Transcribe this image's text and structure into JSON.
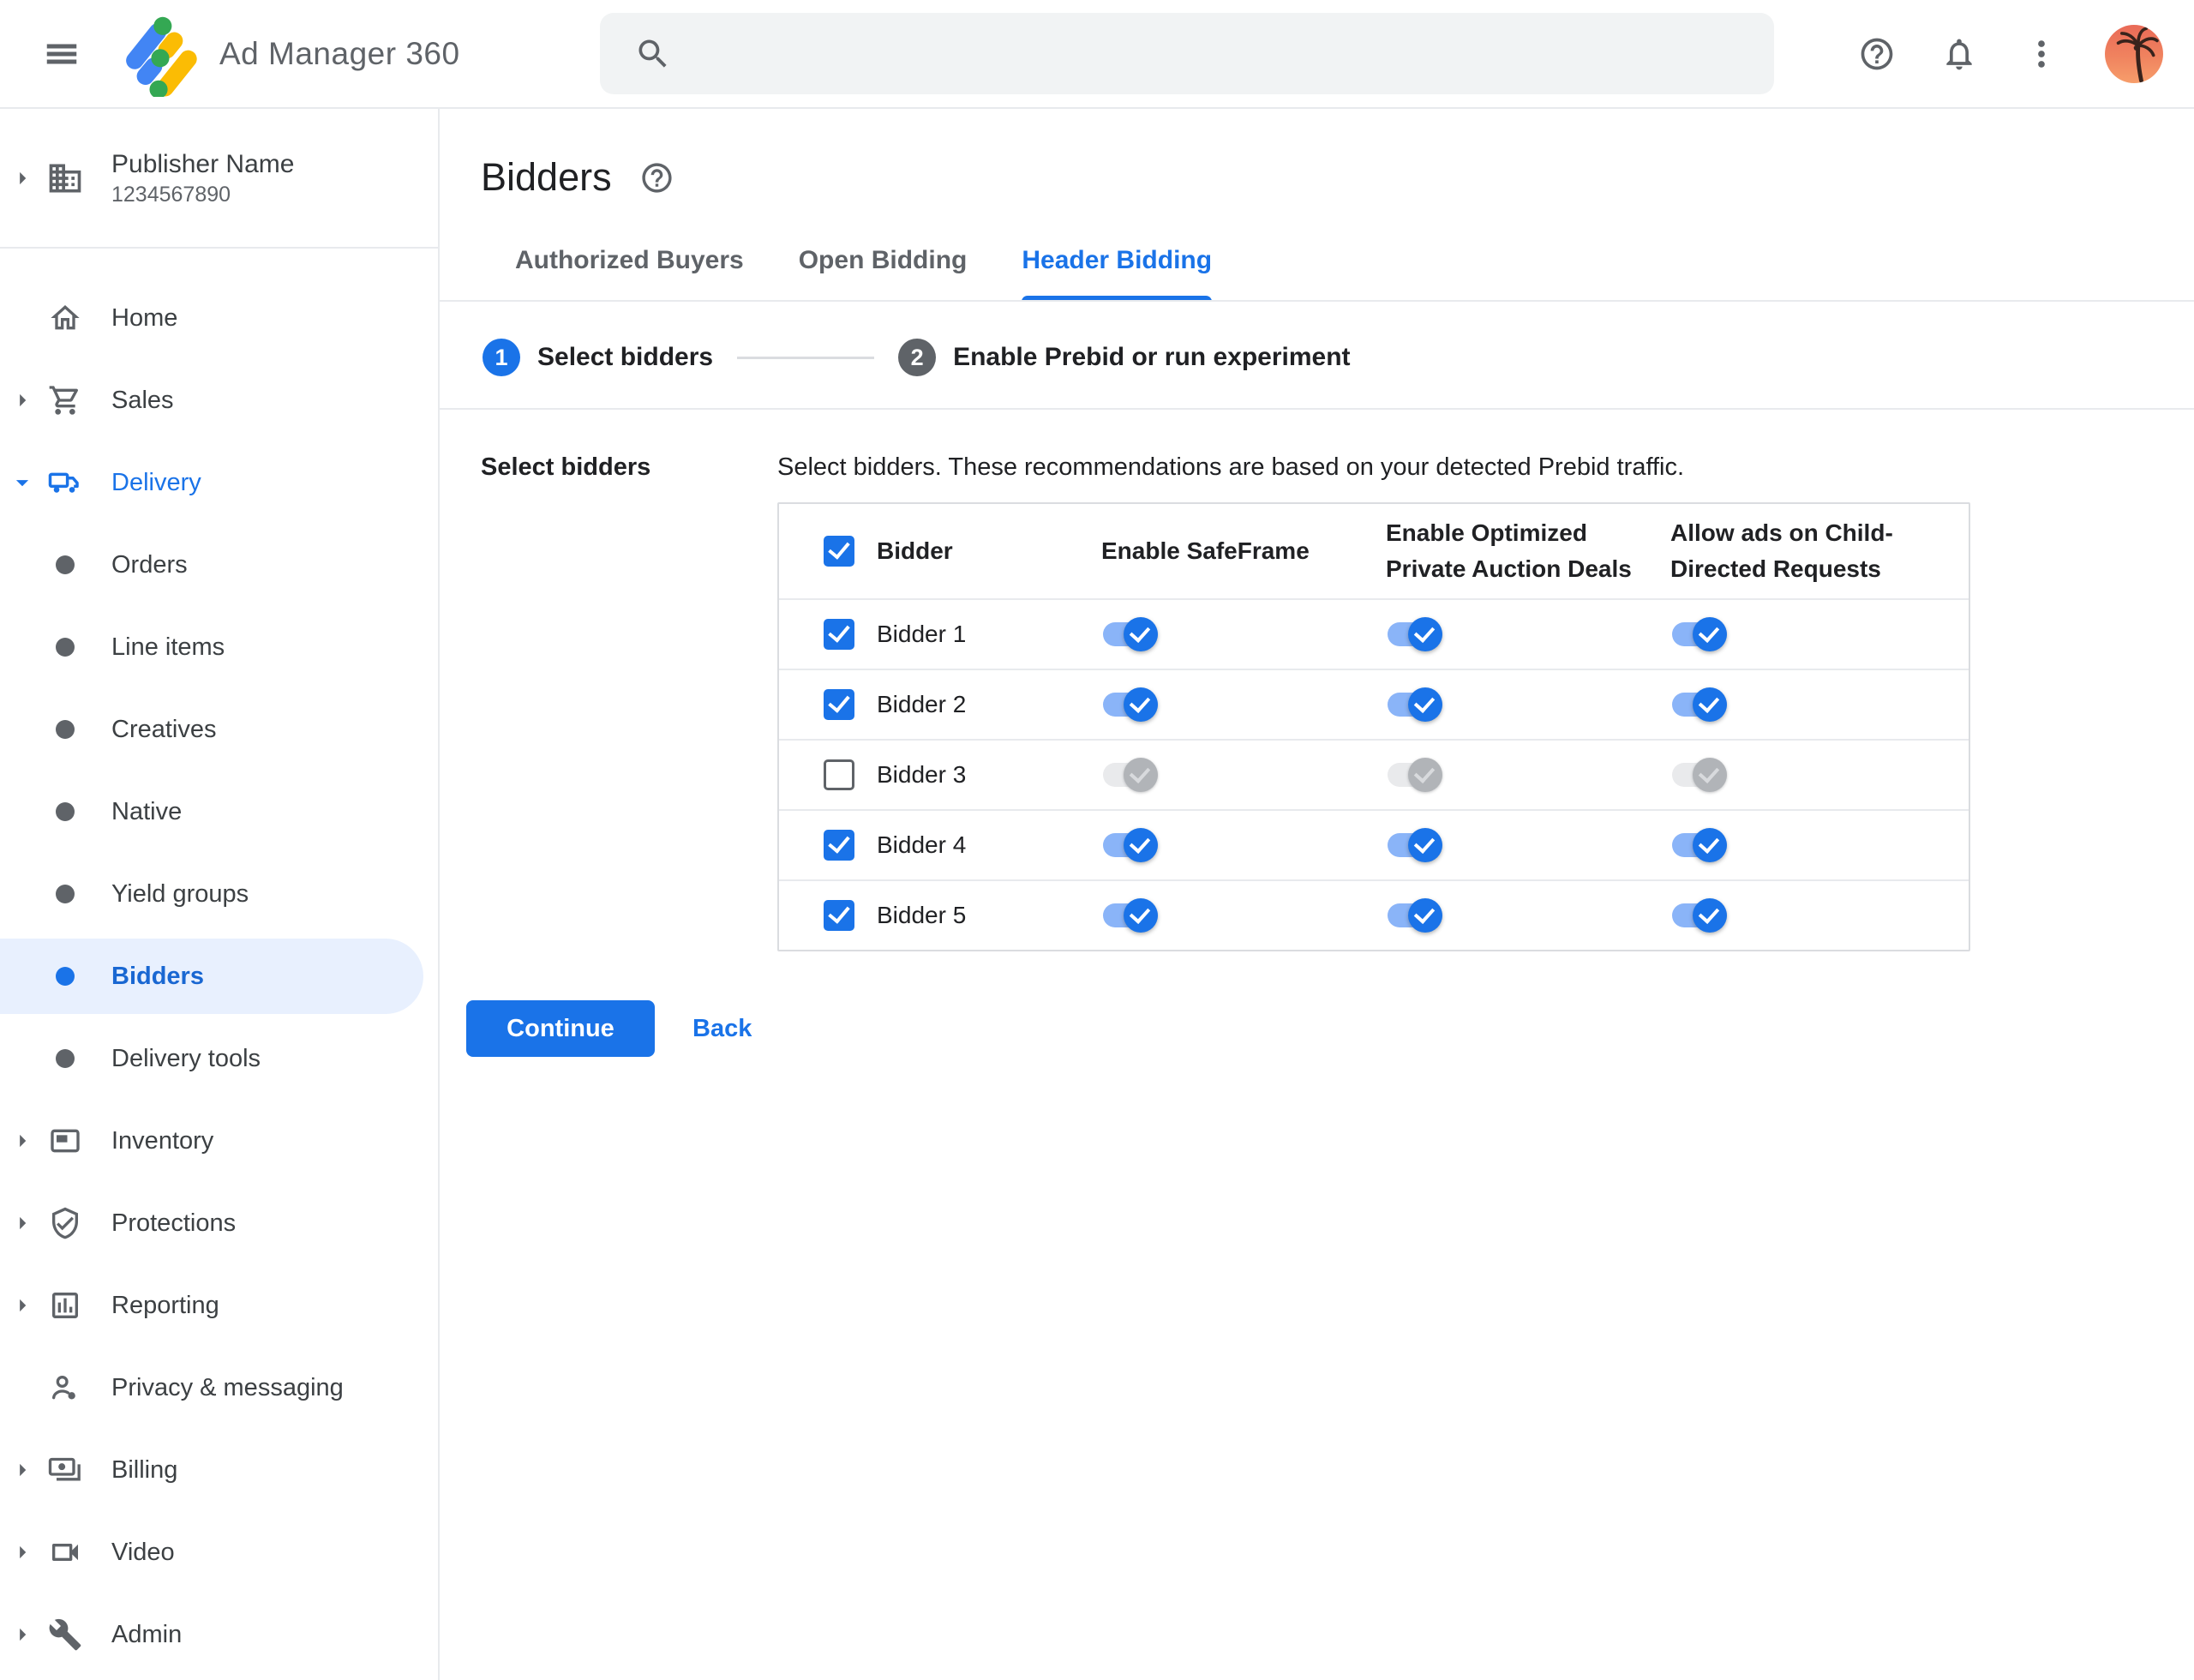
{
  "topbar": {
    "app_title": "Ad Manager 360",
    "search": {
      "value": "",
      "placeholder": ""
    }
  },
  "sidebar": {
    "publisher": {
      "name": "Publisher Name",
      "id": "1234567890"
    },
    "items": [
      {
        "label": "Home"
      },
      {
        "label": "Sales"
      },
      {
        "label": "Delivery"
      },
      {
        "label": "Orders"
      },
      {
        "label": "Line items"
      },
      {
        "label": "Creatives"
      },
      {
        "label": "Native"
      },
      {
        "label": "Yield groups"
      },
      {
        "label": "Bidders"
      },
      {
        "label": "Delivery tools"
      },
      {
        "label": "Inventory"
      },
      {
        "label": "Protections"
      },
      {
        "label": "Reporting"
      },
      {
        "label": "Privacy & messaging"
      },
      {
        "label": "Billing"
      },
      {
        "label": "Video"
      },
      {
        "label": "Admin"
      }
    ],
    "selected_item": "Bidders"
  },
  "main": {
    "page_title": "Bidders",
    "tabs": [
      {
        "label": "Authorized Buyers"
      },
      {
        "label": "Open Bidding"
      },
      {
        "label": "Header Bidding"
      }
    ],
    "active_tab": "Header Bidding",
    "stepper": [
      {
        "number": "1",
        "label": "Select bidders"
      },
      {
        "number": "2",
        "label": "Enable Prebid or run experiment"
      }
    ],
    "section_label": "Select bidders",
    "description": "Select bidders. These recommendations are based on your detected Prebid traffic.",
    "table": {
      "columns": [
        "Bidder",
        "Enable SafeFrame",
        "Enable Optimized Private Auction Deals",
        "Allow ads on Child-Directed Requests"
      ],
      "select_all_checked": true,
      "rows": [
        {
          "label": "Bidder 1",
          "selected": true,
          "enable_safeframe": true,
          "enable_optimized_private_auction_deals": true,
          "allow_ads_on_child_directed_requests": true
        },
        {
          "label": "Bidder 2",
          "selected": true,
          "enable_safeframe": true,
          "enable_optimized_private_auction_deals": true,
          "allow_ads_on_child_directed_requests": true
        },
        {
          "label": "Bidder 3",
          "selected": false,
          "enable_safeframe": false,
          "enable_optimized_private_auction_deals": false,
          "allow_ads_on_child_directed_requests": false
        },
        {
          "label": "Bidder 4",
          "selected": true,
          "enable_safeframe": true,
          "enable_optimized_private_auction_deals": true,
          "allow_ads_on_child_directed_requests": true
        },
        {
          "label": "Bidder 5",
          "selected": true,
          "enable_safeframe": true,
          "enable_optimized_private_auction_deals": true,
          "allow_ads_on_child_directed_requests": true
        }
      ]
    },
    "continue_label": "Continue",
    "back_label": "Back"
  },
  "icons": {
    "topbar": [
      "menu-icon",
      "search-icon",
      "help-icon",
      "notifications-bell-icon",
      "more-vert-icon",
      "avatar"
    ],
    "sidebar": [
      "building-icon",
      "home-icon",
      "cart-icon",
      "truck-icon",
      "ad-unit-icon",
      "shield-check-icon",
      "bar-chart-icon",
      "person-badge-icon",
      "money-bill-icon",
      "video-camera-icon",
      "wrench-icon"
    ]
  },
  "colors": {
    "accent_blue": "#1a73e8",
    "active_tab_blue": "#1a73e8",
    "toggle_track_on": "#8ab4f8",
    "toggle_thumb_on": "#1a73e8",
    "toggle_track_off": "#e9eaec",
    "toggle_thumb_off": "#b1b4b8",
    "selected_item_bg": "#e8f0fe",
    "selected_item_text": "#1967d2",
    "logo_blue": "#4285f4",
    "logo_yellow": "#fbbc04",
    "logo_green": "#34a853"
  }
}
